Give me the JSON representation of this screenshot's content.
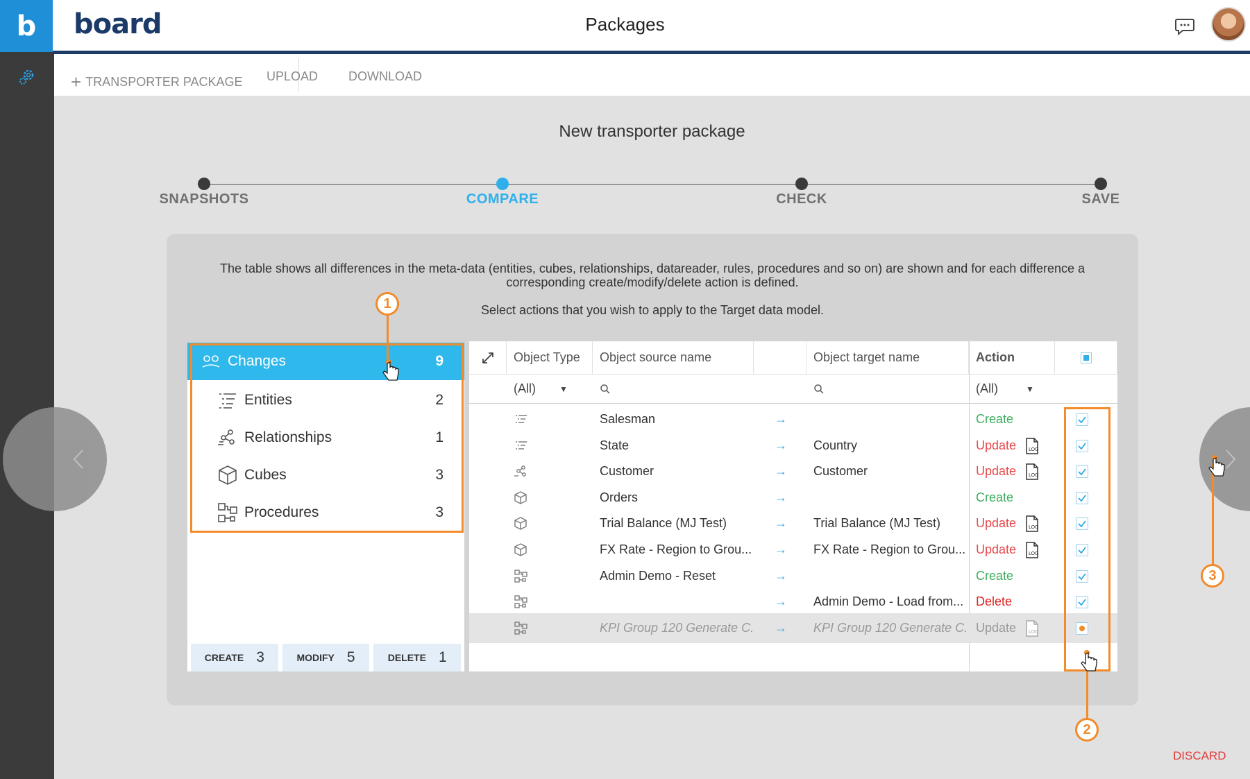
{
  "app": {
    "logo_letter": "b",
    "brand": "board",
    "page_title": "Packages"
  },
  "toolbar": {
    "new_package_label": "TRANSPORTER PACKAGE",
    "upload_label": "UPLOAD",
    "download_label": "DOWNLOAD"
  },
  "wizard": {
    "title": "New transporter package",
    "steps": [
      {
        "label": "SNAPSHOTS",
        "state": "done"
      },
      {
        "label": "COMPARE",
        "state": "active"
      },
      {
        "label": "CHECK",
        "state": "pending"
      },
      {
        "label": "SAVE",
        "state": "pending"
      }
    ],
    "description": "The table shows all differences in the meta-data (entities, cubes, relationships, datareader, rules, procedures and so on) are shown and for each difference a corresponding create/modify/delete action is defined.",
    "instruction": "Select actions that you wish to apply to the Target data model.",
    "discard_label": "DISCARD"
  },
  "categories": [
    {
      "label": "Changes",
      "count": "9",
      "icon": "changes-icon"
    },
    {
      "label": "Entities",
      "count": "2",
      "icon": "entity-icon"
    },
    {
      "label": "Relationships",
      "count": "1",
      "icon": "relationship-icon"
    },
    {
      "label": "Cubes",
      "count": "3",
      "icon": "cube-icon"
    },
    {
      "label": "Procedures",
      "count": "3",
      "icon": "procedure-icon"
    }
  ],
  "summary": {
    "create_label": "CREATE",
    "create_count": "3",
    "modify_label": "MODIFY",
    "modify_count": "5",
    "delete_label": "DELETE",
    "delete_count": "1"
  },
  "table": {
    "headers": {
      "type": "Object Type",
      "source": "Object source name",
      "target": "Object target name",
      "action": "Action"
    },
    "filters": {
      "type": "(All)",
      "action": "(All)"
    },
    "rows": [
      {
        "type_icon": "entity-icon",
        "source": "Salesman",
        "target": "",
        "action": "Create",
        "log": false,
        "checked": true
      },
      {
        "type_icon": "entity-icon",
        "source": "State",
        "target": "Country",
        "action": "Update",
        "log": true,
        "checked": true
      },
      {
        "type_icon": "relationship-icon",
        "source": "Customer",
        "target": "Customer",
        "action": "Update",
        "log": true,
        "checked": true
      },
      {
        "type_icon": "cube-icon",
        "source": "Orders",
        "target": "",
        "action": "Create",
        "log": false,
        "checked": true
      },
      {
        "type_icon": "cube-icon",
        "source": "Trial Balance (MJ Test)",
        "target": "Trial Balance (MJ Test)",
        "action": "Update",
        "log": true,
        "checked": true
      },
      {
        "type_icon": "cube-icon",
        "source": "FX Rate - Region to Grou...",
        "target": "FX Rate - Region to Grou...",
        "action": "Update",
        "log": true,
        "checked": true
      },
      {
        "type_icon": "procedure-icon",
        "source": "Admin Demo - Reset",
        "target": "",
        "action": "Create",
        "log": false,
        "checked": true
      },
      {
        "type_icon": "procedure-icon",
        "source": "",
        "target": "Admin Demo - Load from...",
        "action": "Delete",
        "log": false,
        "checked": true
      },
      {
        "type_icon": "procedure-icon",
        "source": "KPI Group 120 Generate C...",
        "target": "KPI Group 120 Generate C...",
        "action": "Update",
        "log": true,
        "checked": false
      }
    ]
  },
  "annotations": {
    "badge1": "1",
    "badge2": "2",
    "badge3": "3"
  },
  "colors": {
    "accent": "#2fb8ec",
    "annotation": "#f28b2b",
    "create": "#3cae5c",
    "update": "#e8494b"
  }
}
